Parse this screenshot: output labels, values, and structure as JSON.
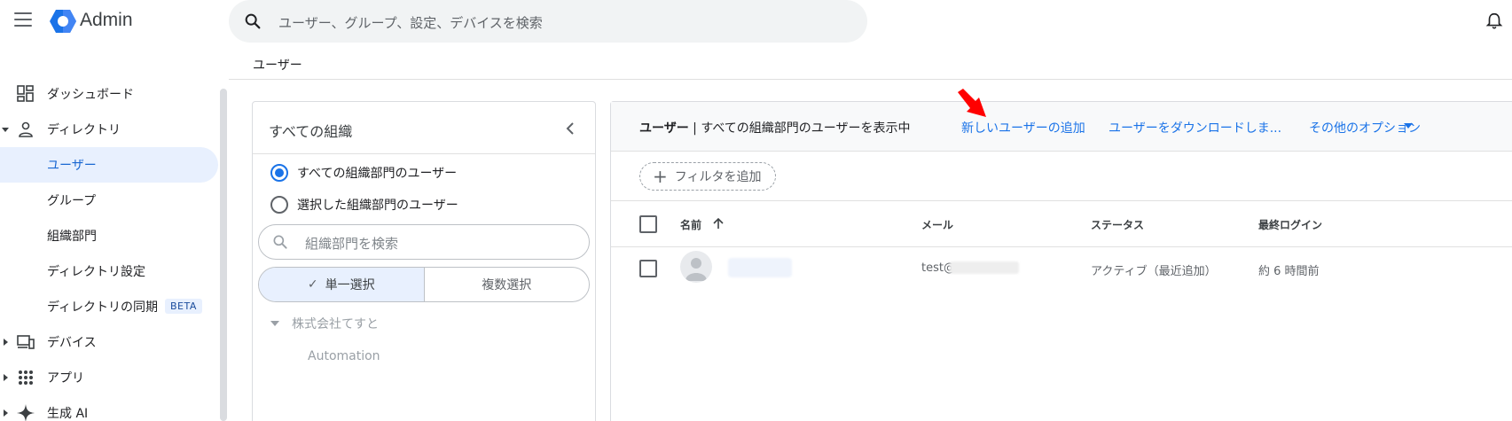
{
  "app": {
    "title": "Admin"
  },
  "search": {
    "placeholder": "ユーザー、グループ、設定、デバイスを検索"
  },
  "breadcrumb": "ユーザー",
  "sidebar": {
    "items": [
      {
        "label": "ダッシュボード",
        "icon": "dashboard-icon"
      },
      {
        "label": "ディレクトリ",
        "icon": "person-icon",
        "expanded": true
      },
      {
        "label": "ユーザー",
        "active": true
      },
      {
        "label": "グループ"
      },
      {
        "label": "組織部門"
      },
      {
        "label": "ディレクトリ設定"
      },
      {
        "label": "ディレクトリの同期",
        "badge": "BETA"
      },
      {
        "label": "デバイス",
        "icon": "devices-icon"
      },
      {
        "label": "アプリ",
        "icon": "apps-grid-icon"
      },
      {
        "label": "生成 AI",
        "icon": "sparkle-icon"
      }
    ]
  },
  "org_panel": {
    "title": "すべての組織",
    "radio_all": "すべての組織部門のユーザー",
    "radio_selected": "選択した組織部門のユーザー",
    "search_placeholder": "組織部門を検索",
    "single_select": "単一選択",
    "multi_select": "複数選択",
    "tree": [
      "株式会社てすと",
      "Automation"
    ]
  },
  "users_panel": {
    "title_bold": "ユーザー",
    "title_rest": " | すべての組織部門のユーザーを表示中",
    "add_user": "新しいユーザーの追加",
    "download_users": "ユーザーをダウンロードしま...",
    "more_options": "その他のオプション",
    "add_filter": "フィルタを追加",
    "columns": {
      "name": "名前",
      "email": "メール",
      "status": "ステータス",
      "last_login": "最終ログイン"
    },
    "rows": [
      {
        "email_prefix": "test@",
        "status": "アクティブ（最近追加）",
        "last_login": "約 6 時間前"
      }
    ]
  },
  "colors": {
    "accent": "#1a73e8",
    "active_bg": "#e8f0fe",
    "annotation_arrow": "#ff0000"
  }
}
